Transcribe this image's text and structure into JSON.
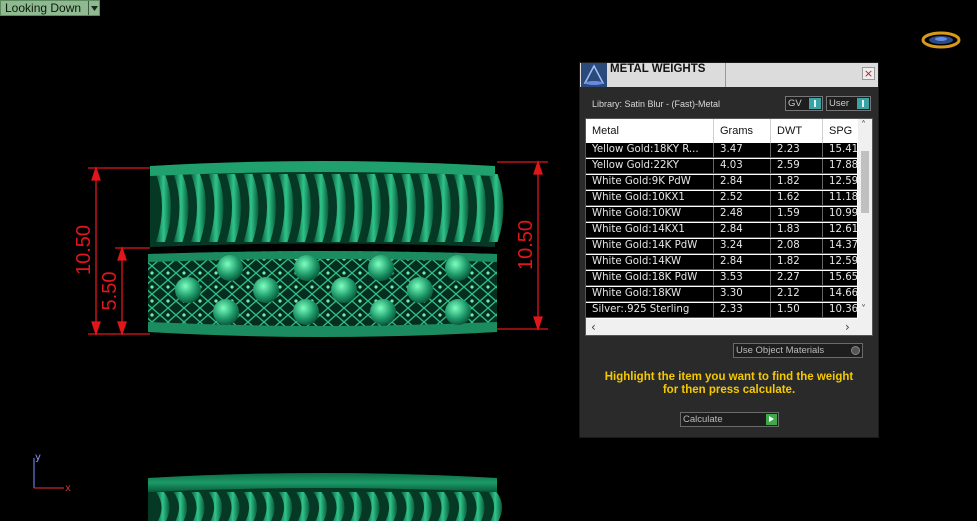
{
  "viewport": {
    "label": "Looking Down"
  },
  "dimensions": {
    "left_outer": "10.50",
    "left_inner": "5.50",
    "right": "10.50"
  },
  "axis": {
    "y": "y",
    "x": "x"
  },
  "panel": {
    "title": "METAL WEIGHTS",
    "close": "×",
    "library": "Library: Satin Blur - (Fast)-Metal",
    "gv_label": "GV",
    "user_label": "User",
    "columns": [
      "Metal",
      "Grams",
      "DWT",
      "SPG"
    ],
    "rows": [
      [
        "Yellow Gold:18KY R...",
        "3.47",
        "2.23",
        "15.41"
      ],
      [
        "Yellow Gold:22KY",
        "4.03",
        "2.59",
        "17.88"
      ],
      [
        "White Gold:9K PdW",
        "2.84",
        "1.82",
        "12.59"
      ],
      [
        "White Gold:10KX1",
        "2.52",
        "1.62",
        "11.18"
      ],
      [
        "White Gold:10KW",
        "2.48",
        "1.59",
        "10.99"
      ],
      [
        "White Gold:14KX1",
        "2.84",
        "1.83",
        "12.61"
      ],
      [
        "White Gold:14K PdW",
        "3.24",
        "2.08",
        "14.37"
      ],
      [
        "White Gold:14KW",
        "2.84",
        "1.82",
        "12.59"
      ],
      [
        "White Gold:18K PdW",
        "3.53",
        "2.27",
        "15.65"
      ],
      [
        "White Gold:18KW",
        "3.30",
        "2.12",
        "14.66"
      ],
      [
        "Silver:.925 Sterling",
        "2.33",
        "1.50",
        "10.36"
      ]
    ],
    "use_object_materials": "Use Object Materials",
    "hint_line1": "Highlight the item you want to find the weight",
    "hint_line2": "for then press calculate.",
    "calculate": "Calculate"
  },
  "colors": {
    "ring": "#1f9a6a",
    "dimension": "#e0161b",
    "hint": "#f5c900"
  }
}
